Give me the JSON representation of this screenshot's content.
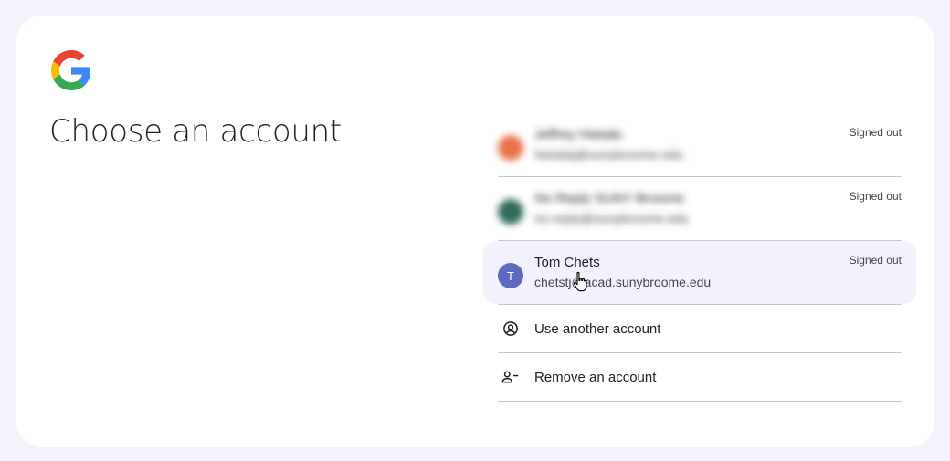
{
  "heading": "Choose an account",
  "accounts": [
    {
      "name": "Jeffrey Hietala",
      "email": "hietalaj@sunybroome.edu",
      "status": "Signed out",
      "avatar_letter": "",
      "avatar_color": "#e8714a",
      "blurred": true
    },
    {
      "name": "No Reply SUNY Broome",
      "email": "no-reply@sunybroome.edu",
      "status": "Signed out",
      "avatar_letter": "",
      "avatar_color": "#2f6b5a",
      "blurred": true
    },
    {
      "name": "Tom Chets",
      "email": "chetstj@acad.sunybroome.edu",
      "status": "Signed out",
      "avatar_letter": "T",
      "avatar_color": "#5c6bc0",
      "blurred": false
    }
  ],
  "actions": {
    "use_another": "Use another account",
    "remove": "Remove an account"
  },
  "icons": {
    "logo": "google-g-logo",
    "use_another": "account-circle-icon",
    "remove": "person-remove-icon",
    "cursor": "hand-pointer-cursor"
  },
  "colors": {
    "background": "#f3f3fb",
    "card": "#ffffff",
    "hover": "#f3f1fb",
    "divider": "#c4c7c5"
  }
}
